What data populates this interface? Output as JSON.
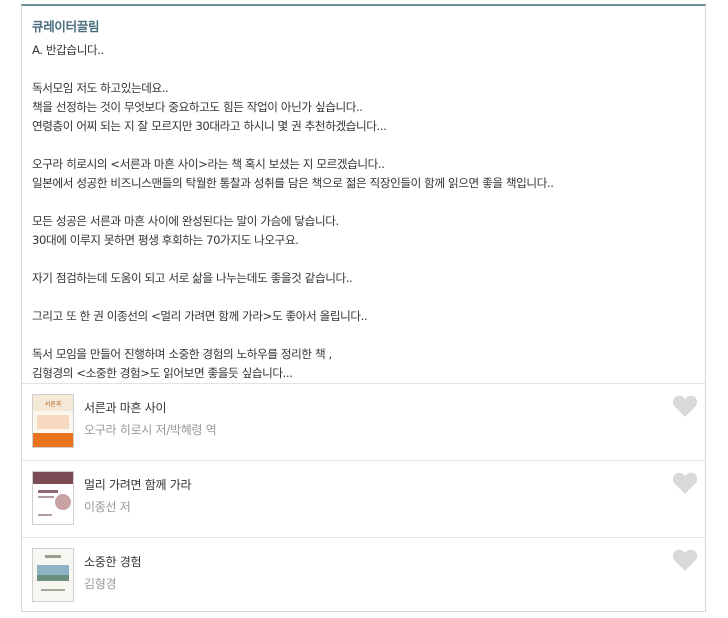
{
  "curator": {
    "title": "큐레이터끌림"
  },
  "answer": {
    "paragraphs": [
      [
        "A. 반갑습니다.."
      ],
      [
        "독서모임 저도 하고있는데요..",
        "책을 선정하는 것이 무엇보다 중요하고도 힘든 작업이 아닌가 싶습니다..",
        "연령층이 어찌 되는 지 잘 모르지만 30대라고 하시니 몇 권 추천하겠습니다..."
      ],
      [
        "오구라 히로시의 <서른과 마흔 사이>라는 책 혹시 보셨는 지 모르겠습니다..",
        "일본에서 성공한 비즈니스맨들의 탁월한 통찰과 성취를 담은 책으로 젊은 직장인들이 함께 읽으면 좋을 책입니다.."
      ],
      [
        "모든 성공은 서른과 마흔 사이에 완성된다는 말이 가슴에 닿습니다.",
        "30대에 이루지 못하면 평생 후회하는 70가지도 나오구요."
      ],
      [
        "자기 점검하는데 도움이 되고 서로 삶을 나누는데도 좋을것 같습니다.."
      ],
      [
        "그리고 또 한 권 이종선의 <멀리 가려면 함께 가라>도 좋아서 올립니다.."
      ],
      [
        "독서 모임을 만들어 진행하며 소중한 경험의 노하우를 정리한 책 ,",
        "김형경의 <소중한 경험>도 읽어보면 좋을듯 싶습니다..."
      ]
    ]
  },
  "books": [
    {
      "title": "서른과 마흔 사이",
      "author": "오구라 히로시 저/박혜령 역",
      "cover_color": "#e8741f",
      "icon": "heart-icon"
    },
    {
      "title": "멀리 가려면 함께 가라",
      "author": "이종선 저",
      "cover_color": "#7b4b55",
      "icon": "heart-icon"
    },
    {
      "title": "소중한 경험",
      "author": "김형경",
      "cover_color": "#f2f1ea",
      "icon": "heart-icon"
    }
  ]
}
